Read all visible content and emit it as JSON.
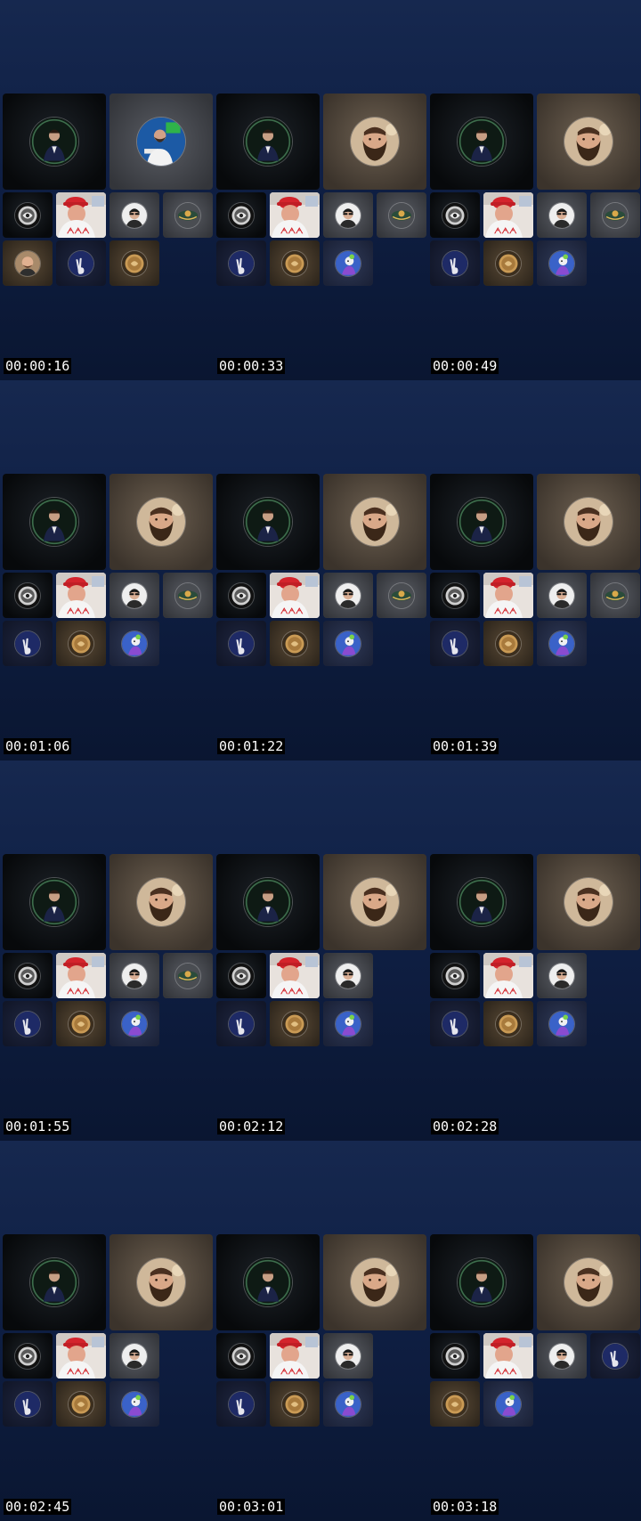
{
  "frames": [
    {
      "timestamp": "00:00:16",
      "layout": "A"
    },
    {
      "timestamp": "00:00:33",
      "layout": "B"
    },
    {
      "timestamp": "00:00:49",
      "layout": "B"
    },
    {
      "timestamp": "00:01:06",
      "layout": "C"
    },
    {
      "timestamp": "00:01:22",
      "layout": "C"
    },
    {
      "timestamp": "00:01:39",
      "layout": "C"
    },
    {
      "timestamp": "00:01:55",
      "layout": "C"
    },
    {
      "timestamp": "00:02:12",
      "layout": "D"
    },
    {
      "timestamp": "00:02:28",
      "layout": "D"
    },
    {
      "timestamp": "00:02:45",
      "layout": "D"
    },
    {
      "timestamp": "00:03:01",
      "layout": "D"
    },
    {
      "timestamp": "00:03:18",
      "layout": "E"
    }
  ],
  "participants": {
    "host-suit": {
      "icon": "person-suit-avatar-icon",
      "bg": "dark"
    },
    "bearded-man": {
      "icon": "bearded-man-avatar-icon",
      "bg": "warm"
    },
    "studio-man": {
      "icon": "studio-man-avatar-icon",
      "bg": "grey"
    },
    "silver-logo": {
      "icon": "silver-emblem-avatar-icon",
      "bg": "dark"
    },
    "red-cap-video": {
      "icon": "red-cap-man-video-icon",
      "bg": "video"
    },
    "sunglasses-man": {
      "icon": "sunglasses-man-avatar-icon",
      "bg": "grey"
    },
    "gold-emblem": {
      "icon": "gold-emblem-avatar-icon",
      "bg": "grey"
    },
    "bald-man": {
      "icon": "bald-man-avatar-icon",
      "bg": "brown"
    },
    "peace-hand": {
      "icon": "peace-hand-avatar-icon",
      "bg": "navy"
    },
    "gold-coin": {
      "icon": "gold-coin-avatar-icon",
      "bg": "brown"
    },
    "cartoon": {
      "icon": "cartoon-avatar-icon",
      "bg": "slate"
    }
  },
  "colors": {
    "background_top": "#16284f",
    "background_bottom": "#0a1631",
    "timestamp_text": "#ffffff",
    "timestamp_bg": "#000000"
  }
}
